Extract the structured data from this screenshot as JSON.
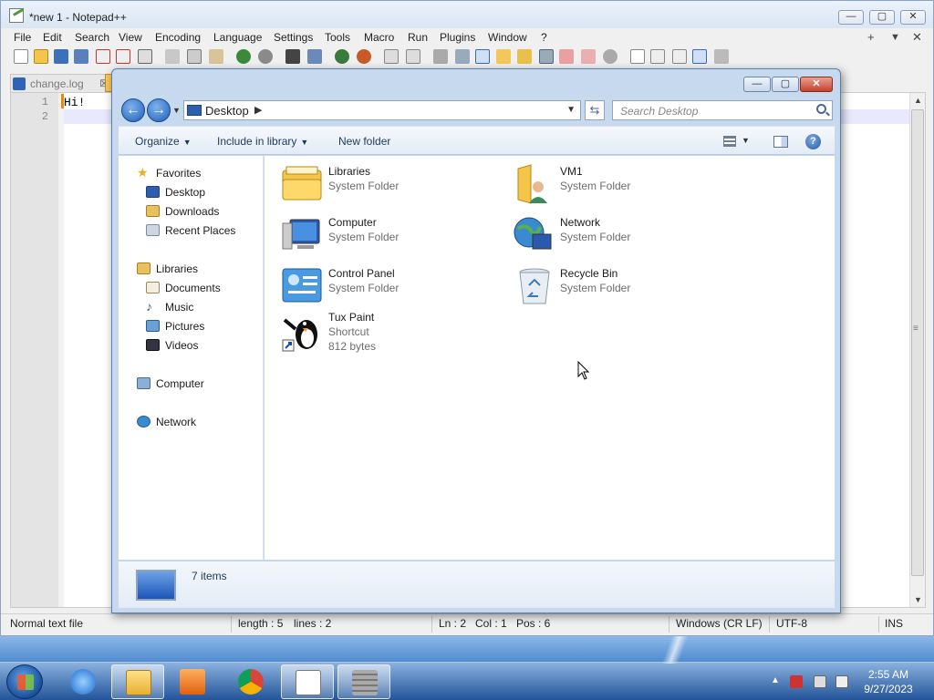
{
  "npp": {
    "title": "*new 1 - Notepad++",
    "menu": [
      "File",
      "Edit",
      "Search",
      "View",
      "Encoding",
      "Language",
      "Settings",
      "Tools",
      "Macro",
      "Run",
      "Plugins",
      "Window",
      "?"
    ],
    "menu_right": [
      "+",
      "▼",
      "✕"
    ],
    "tab_label": "change.log",
    "line_numbers": [
      "1",
      "2"
    ],
    "code_line1": "Hi!",
    "status": {
      "file_type": "Normal text file",
      "length": "length : 5",
      "lines": "lines : 2",
      "ln": "Ln : 2",
      "col": "Col : 1",
      "pos": "Pos : 6",
      "eol": "Windows (CR LF)",
      "encoding": "UTF-8",
      "mode": "INS"
    }
  },
  "explorer": {
    "address": "Desktop",
    "search_placeholder": "Search Desktop",
    "commands": {
      "organize": "Organize",
      "include": "Include in library",
      "new_folder": "New folder"
    },
    "nav": {
      "favorites": "Favorites",
      "desktop": "Desktop",
      "downloads": "Downloads",
      "recent": "Recent Places",
      "libraries": "Libraries",
      "documents": "Documents",
      "music": "Music",
      "pictures": "Pictures",
      "videos": "Videos",
      "computer": "Computer",
      "network": "Network"
    },
    "items": [
      {
        "name": "Libraries",
        "type": "System Folder",
        "icon": "libraries-icon"
      },
      {
        "name": "VM1",
        "type": "System Folder",
        "icon": "user-folder-icon"
      },
      {
        "name": "Computer",
        "type": "System Folder",
        "icon": "computer-icon"
      },
      {
        "name": "Network",
        "type": "System Folder",
        "icon": "network-icon"
      },
      {
        "name": "Control Panel",
        "type": "System Folder",
        "icon": "control-panel-icon"
      },
      {
        "name": "Recycle Bin",
        "type": "System Folder",
        "icon": "recycle-bin-icon"
      },
      {
        "name": "Tux Paint",
        "type": "Shortcut",
        "size": "812 bytes",
        "icon": "tux-paint-icon"
      }
    ],
    "item_count": "7 items"
  },
  "taskbar": {
    "time": "2:55 AM",
    "date": "9/27/2023"
  }
}
